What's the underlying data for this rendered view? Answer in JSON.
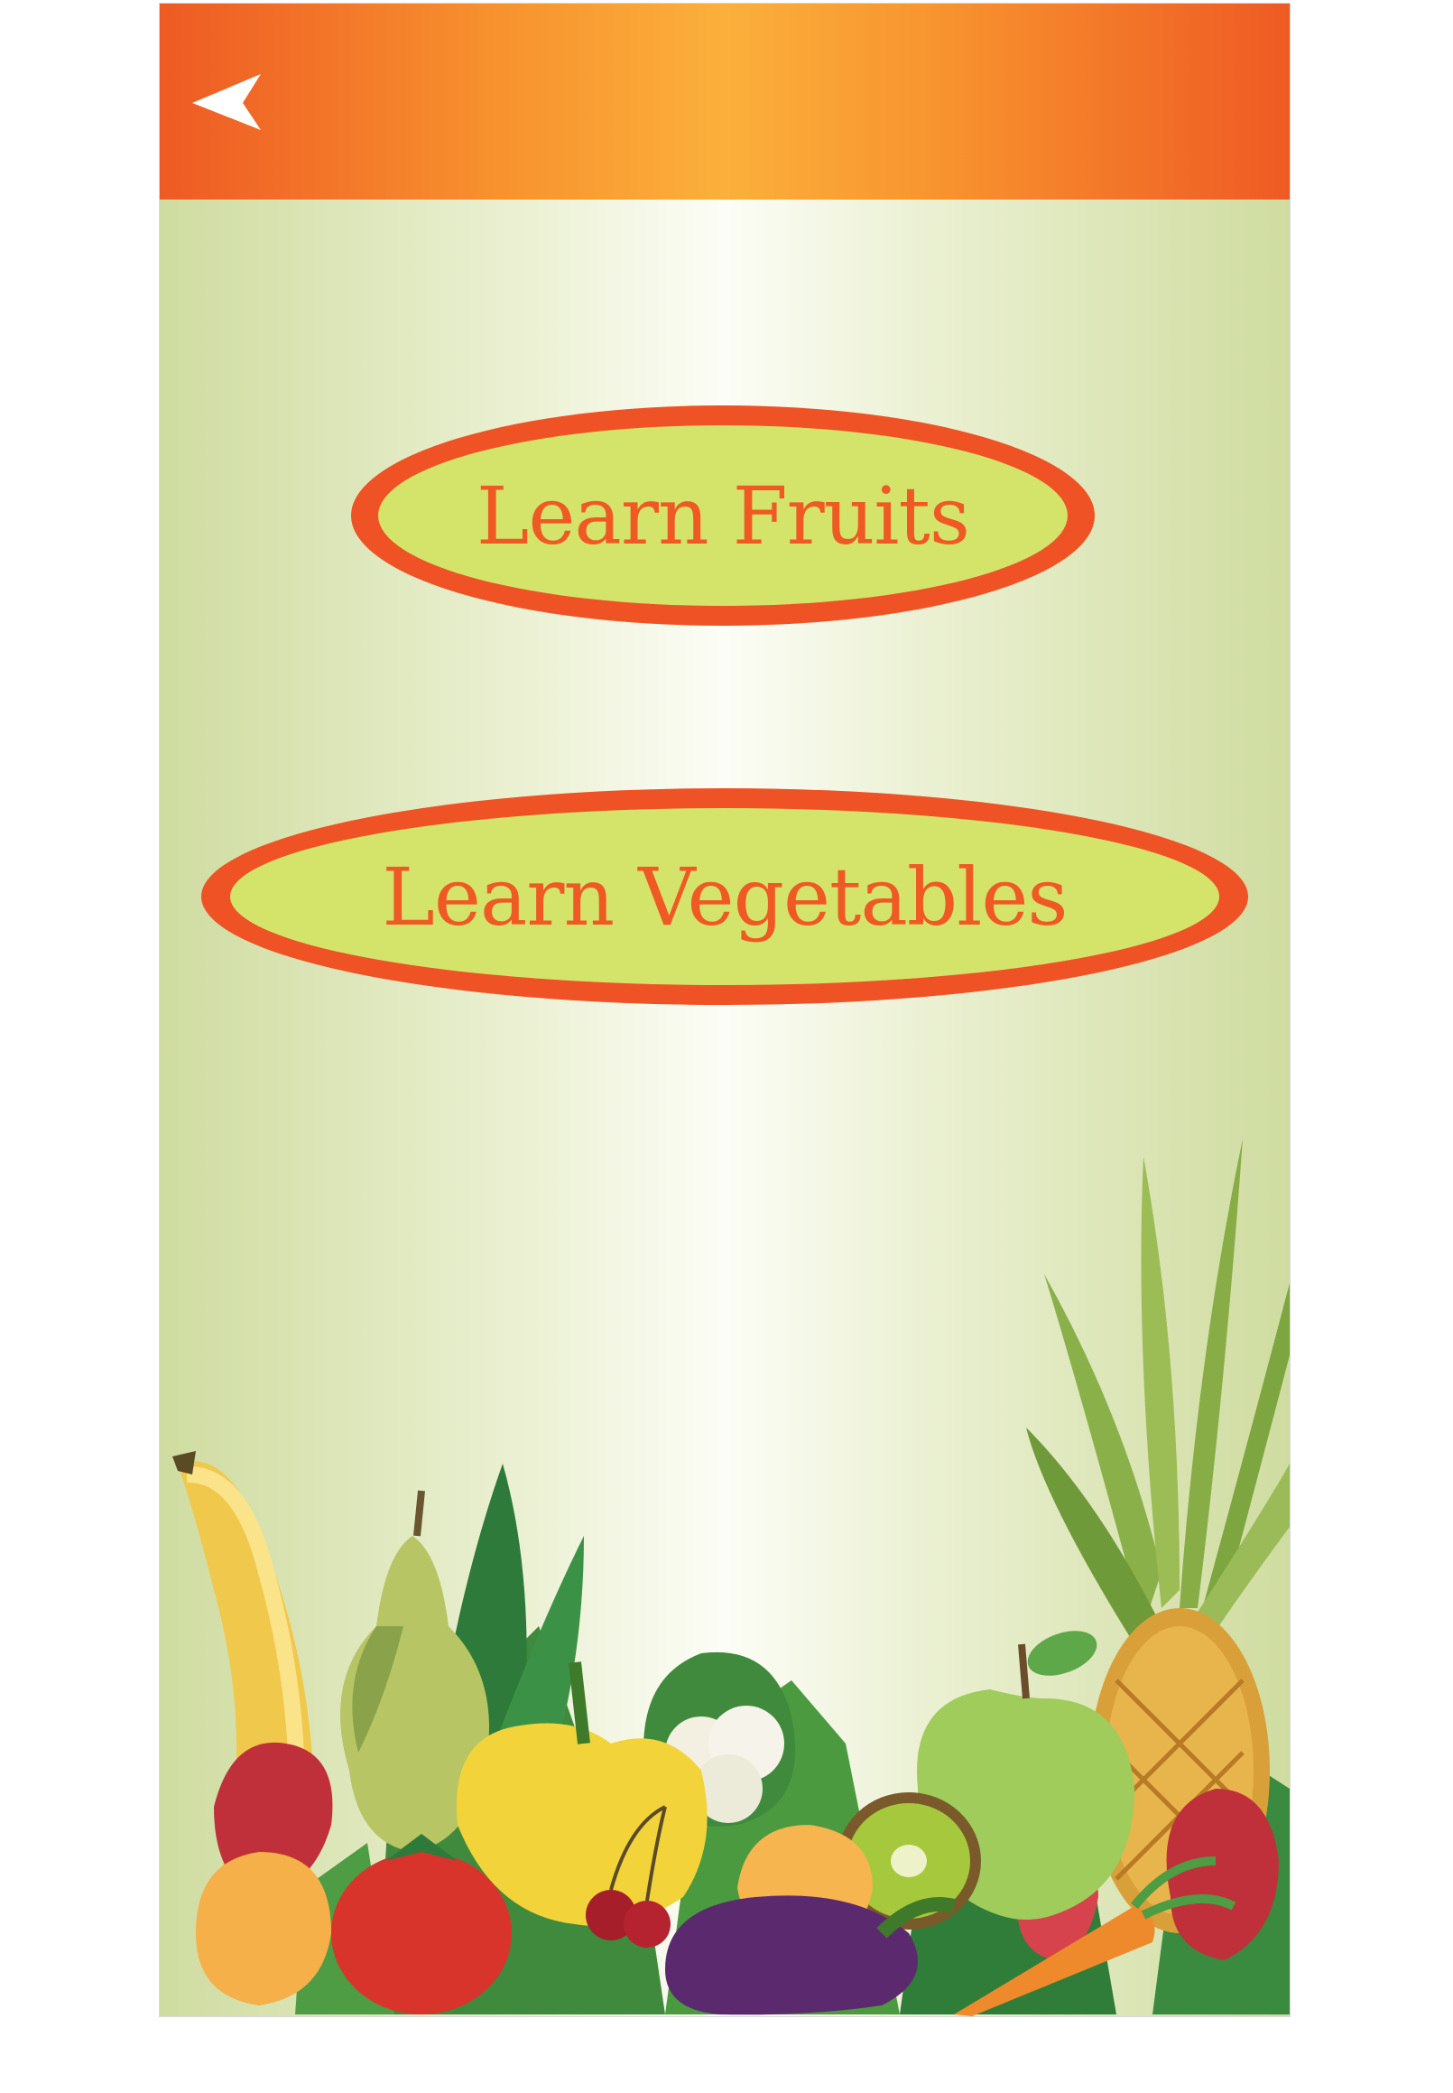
{
  "app": {
    "header": {
      "back_icon": "back-arrow-icon",
      "bar_colors": [
        "#ee5a24",
        "#fbb03b"
      ]
    },
    "menu": {
      "learn_fruits_label": "Learn Fruits",
      "learn_vegetables_label": "Learn Vegetables"
    },
    "colors": {
      "button_fill": "#d4e46a",
      "button_border": "#ef5224",
      "button_text": "#ef5a24",
      "background": "#e9efcf"
    },
    "illustration": {
      "items": [
        "banana-icon",
        "pear-icon",
        "strawberry-icon",
        "peach-icon",
        "tomato-icon",
        "bell-pepper-icon",
        "cauliflower-icon",
        "cherry-icon",
        "kiwi-icon",
        "eggplant-icon",
        "apple-icon",
        "pineapple-icon",
        "carrot-icon",
        "leaves-icon"
      ]
    }
  }
}
